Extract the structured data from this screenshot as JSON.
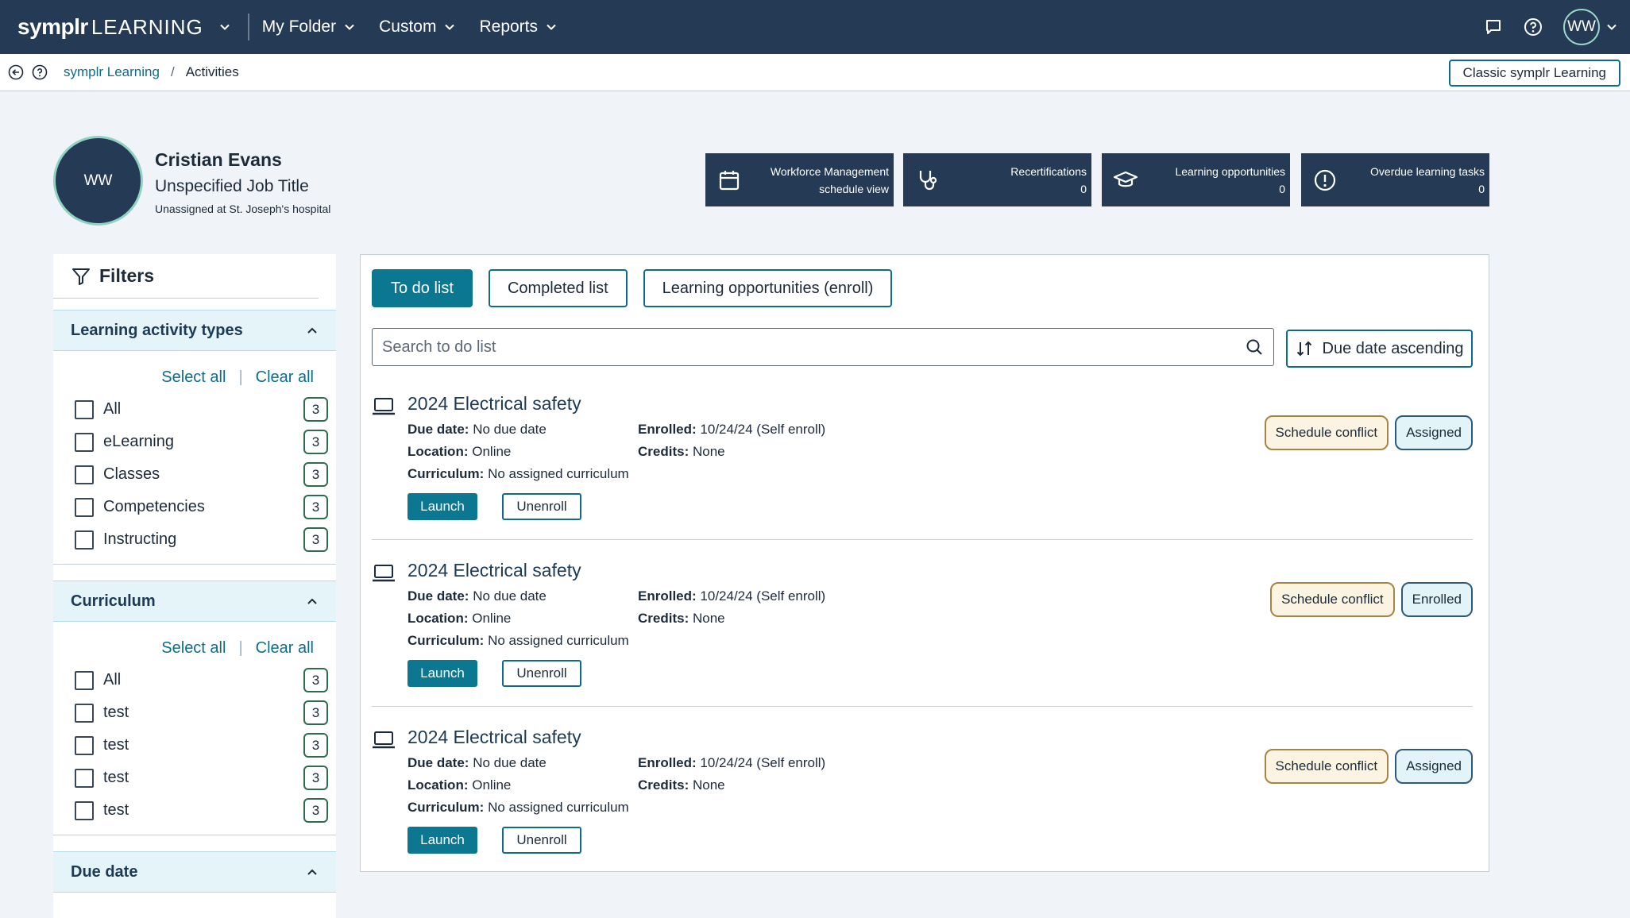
{
  "nav": {
    "brand_logo": "symplr",
    "brand_sub": "LEARNING",
    "items": [
      {
        "label": "My Folder"
      },
      {
        "label": "Custom"
      },
      {
        "label": "Reports"
      }
    ],
    "avatar_initials": "WW"
  },
  "breadcrumb": {
    "root": "symplr Learning",
    "separator": "/",
    "current": "Activities",
    "classic_button": "Classic symplr Learning"
  },
  "profile": {
    "initials": "WW",
    "name": "Cristian Evans",
    "job_title": "Unspecified Job Title",
    "location": "Unassigned at St. Joseph's hospital"
  },
  "stats": [
    {
      "line1": "Workforce Management",
      "line2": "schedule view",
      "icon": "calendar-icon"
    },
    {
      "line1": "Recertifications",
      "line2": "0",
      "icon": "stethoscope-icon"
    },
    {
      "line1": "Learning opportunities",
      "line2": "0",
      "icon": "graduation-cap-icon"
    },
    {
      "line1": "Overdue learning tasks",
      "line2": "0",
      "icon": "alert-circle-icon"
    }
  ],
  "filters": {
    "title": "Filters",
    "select_all": "Select all",
    "clear_all": "Clear all",
    "activity_types": {
      "title": "Learning activity types",
      "items": [
        {
          "label": "All",
          "count": "3"
        },
        {
          "label": "eLearning",
          "count": "3"
        },
        {
          "label": "Classes",
          "count": "3"
        },
        {
          "label": "Competencies",
          "count": "3"
        },
        {
          "label": "Instructing",
          "count": "3"
        }
      ]
    },
    "curriculum": {
      "title": "Curriculum",
      "items": [
        {
          "label": "All",
          "count": "3"
        },
        {
          "label": "test",
          "count": "3"
        },
        {
          "label": "test",
          "count": "3"
        },
        {
          "label": "test",
          "count": "3"
        },
        {
          "label": "test",
          "count": "3"
        }
      ]
    },
    "due_date": {
      "title": "Due date"
    }
  },
  "tabs": [
    "To do list",
    "Completed list",
    "Learning opportunities (enroll)"
  ],
  "search": {
    "placeholder": "Search to do list"
  },
  "sort": {
    "label": "Due date ascending"
  },
  "labels": {
    "due_date": "Due date:",
    "location": "Location:",
    "curriculum": "Curriculum:",
    "enrolled": "Enrolled:",
    "credits": "Credits:",
    "launch": "Launch",
    "unenroll": "Unenroll"
  },
  "activities": [
    {
      "title": "2024 Electrical safety",
      "due_date": "No due date",
      "location": "Online",
      "curriculum": "No assigned curriculum",
      "enrolled": "10/24/24 (Self enroll)",
      "credits": "None",
      "badges": [
        "Schedule conflict",
        "Assigned"
      ]
    },
    {
      "title": "2024 Electrical safety",
      "due_date": "No due date",
      "location": "Online",
      "curriculum": "No assigned curriculum",
      "enrolled": "10/24/24 (Self enroll)",
      "credits": "None",
      "badges": [
        "Schedule conflict",
        "Enrolled"
      ]
    },
    {
      "title": "2024 Electrical safety",
      "due_date": "No due date",
      "location": "Online",
      "curriculum": "No assigned curriculum",
      "enrolled": "10/24/24 (Self enroll)",
      "credits": "None",
      "badges": [
        "Schedule conflict",
        "Assigned"
      ]
    }
  ],
  "colors": {
    "nav_bg": "#243a55",
    "accent": "#0b7791",
    "link": "#0b6d8a",
    "page_bg": "#f0f3f7",
    "warn_badge_bg": "#fbf4e3",
    "info_badge_bg": "#e3f4f8"
  }
}
